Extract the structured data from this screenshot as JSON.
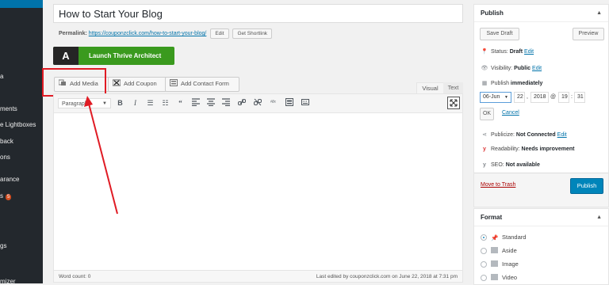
{
  "sidebar": {
    "items": [
      {
        "label": "a"
      },
      {
        "label": "ments"
      },
      {
        "label": "e Lightboxes"
      },
      {
        "label": "back"
      },
      {
        "label": "ons"
      },
      {
        "label": "arance"
      },
      {
        "label": "s",
        "badge": "5"
      },
      {
        "label": "gs"
      },
      {
        "label": "mizer"
      }
    ]
  },
  "post": {
    "title": "How to Start Your Blog",
    "permalink_label": "Permalink:",
    "permalink_url": "https://couponzclick.com/how-to-start-your-blog/",
    "edit_label": "Edit",
    "shortlink_label": "Get Shortlink"
  },
  "thrive": {
    "logo": "A",
    "label": "Launch Thrive Architect"
  },
  "media_buttons": {
    "add_media": "Add Media",
    "add_coupon": "Add Coupon",
    "add_contact_form": "Add Contact Form"
  },
  "editor_tabs": {
    "visual": "Visual",
    "text": "Text"
  },
  "toolbar": {
    "format_select": "Paragraph",
    "icons": [
      "bold-icon",
      "italic-icon",
      "bullet-list-icon",
      "numbered-list-icon",
      "blockquote-icon",
      "align-left-icon",
      "align-center-icon",
      "align-right-icon",
      "link-icon",
      "unlink-icon",
      "spellcheck-icon",
      "toolbar-toggle-icon",
      "keyboard-icon",
      "fullscreen-icon"
    ]
  },
  "status_bar": {
    "word_count": "Word count: 0",
    "last_edited": "Last edited by couponzclick.com on June 22, 2018 at 7:31 pm"
  },
  "publish": {
    "heading": "Publish",
    "save_draft": "Save Draft",
    "preview": "Preview",
    "status_label": "Status:",
    "status_value": "Draft",
    "visibility_label": "Visibility:",
    "visibility_value": "Public",
    "publish_label": "Publish",
    "publish_value": "immediately",
    "edit": "Edit",
    "date": {
      "month": "06-Jun",
      "day": "22",
      "year": "2018",
      "at": "@",
      "hour": "19",
      "minute": "31",
      "comma": ",",
      "colon": ":"
    },
    "ok": "OK",
    "cancel": "Cancel",
    "publicize_label": "Publicize:",
    "publicize_value": "Not Connected",
    "readability_label": "Readability:",
    "readability_value": "Needs improvement",
    "seo_label": "SEO:",
    "seo_value": "Not available",
    "move_to_trash": "Move to Trash",
    "publish_button": "Publish"
  },
  "format_box": {
    "heading": "Format",
    "options": [
      {
        "label": "Standard",
        "selected": true,
        "icon": "pin-icon"
      },
      {
        "label": "Aside",
        "selected": false,
        "icon": "aside-icon"
      },
      {
        "label": "Image",
        "selected": false,
        "icon": "image-icon"
      },
      {
        "label": "Video",
        "selected": false,
        "icon": "video-icon"
      }
    ]
  },
  "colors": {
    "sidebar": "#23282d",
    "accent": "#0073aa",
    "thrive_green": "#3a9a1e",
    "publish_blue": "#0085ba",
    "annotation_red": "#e01b24",
    "trash_red": "#a00"
  }
}
